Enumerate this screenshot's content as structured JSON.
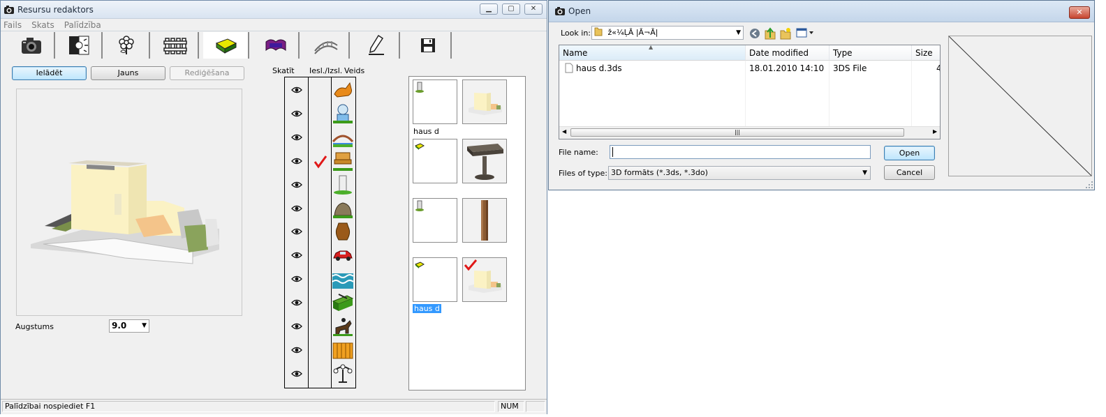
{
  "main_window": {
    "title": "Resursu redaktors",
    "menu": [
      "Fails",
      "Skats",
      "Palīdzība"
    ],
    "toolbar_icons": [
      "camera-icon",
      "day-night-icon",
      "flower-icon",
      "fence-icon",
      "bench-icon",
      "carpet-icon",
      "bridge-icon",
      "pencil-icon",
      "save-icon"
    ],
    "buttons": {
      "load": "Ielādēt",
      "new": "Jauns",
      "edit": "Rediģēšana"
    },
    "height_label": "Augstums",
    "height_value": "9.0",
    "layers": {
      "headers": {
        "view": "Skatīt",
        "incl": "Iesl./Izsl.",
        "type": "Veids"
      },
      "type_icons": [
        "cat-icon",
        "person-icon",
        "bridge-icon",
        "bench-icon",
        "column-icon",
        "rock-icon",
        "vase-icon",
        "car-icon",
        "water-icon",
        "hedge-icon",
        "horse-rider-icon",
        "fence-icon",
        "lamp-icon"
      ],
      "checked_row": 3
    },
    "thumbnails": {
      "group1_label": "haus d",
      "selected_label": "haus d"
    },
    "status": {
      "help": "Palīdzībai nospiediet F1",
      "num": "NUM"
    }
  },
  "open_dialog": {
    "title": "Open",
    "look_in_label": "Look in:",
    "look_in_value": "ž«¼ĻĀ |Ā¬Ā|",
    "columns": [
      "Name",
      "Date modified",
      "Type",
      "Size"
    ],
    "files": [
      {
        "name": "haus d.3ds",
        "date": "18.01.2010 14:10",
        "type": "3DS File",
        "size": "4"
      }
    ],
    "file_name_label": "File name:",
    "file_name_value": "",
    "files_of_type_label": "Files of type:",
    "files_of_type_value": "3D formāts (*.3ds, *.3do)",
    "open_button": "Open",
    "cancel_button": "Cancel"
  }
}
